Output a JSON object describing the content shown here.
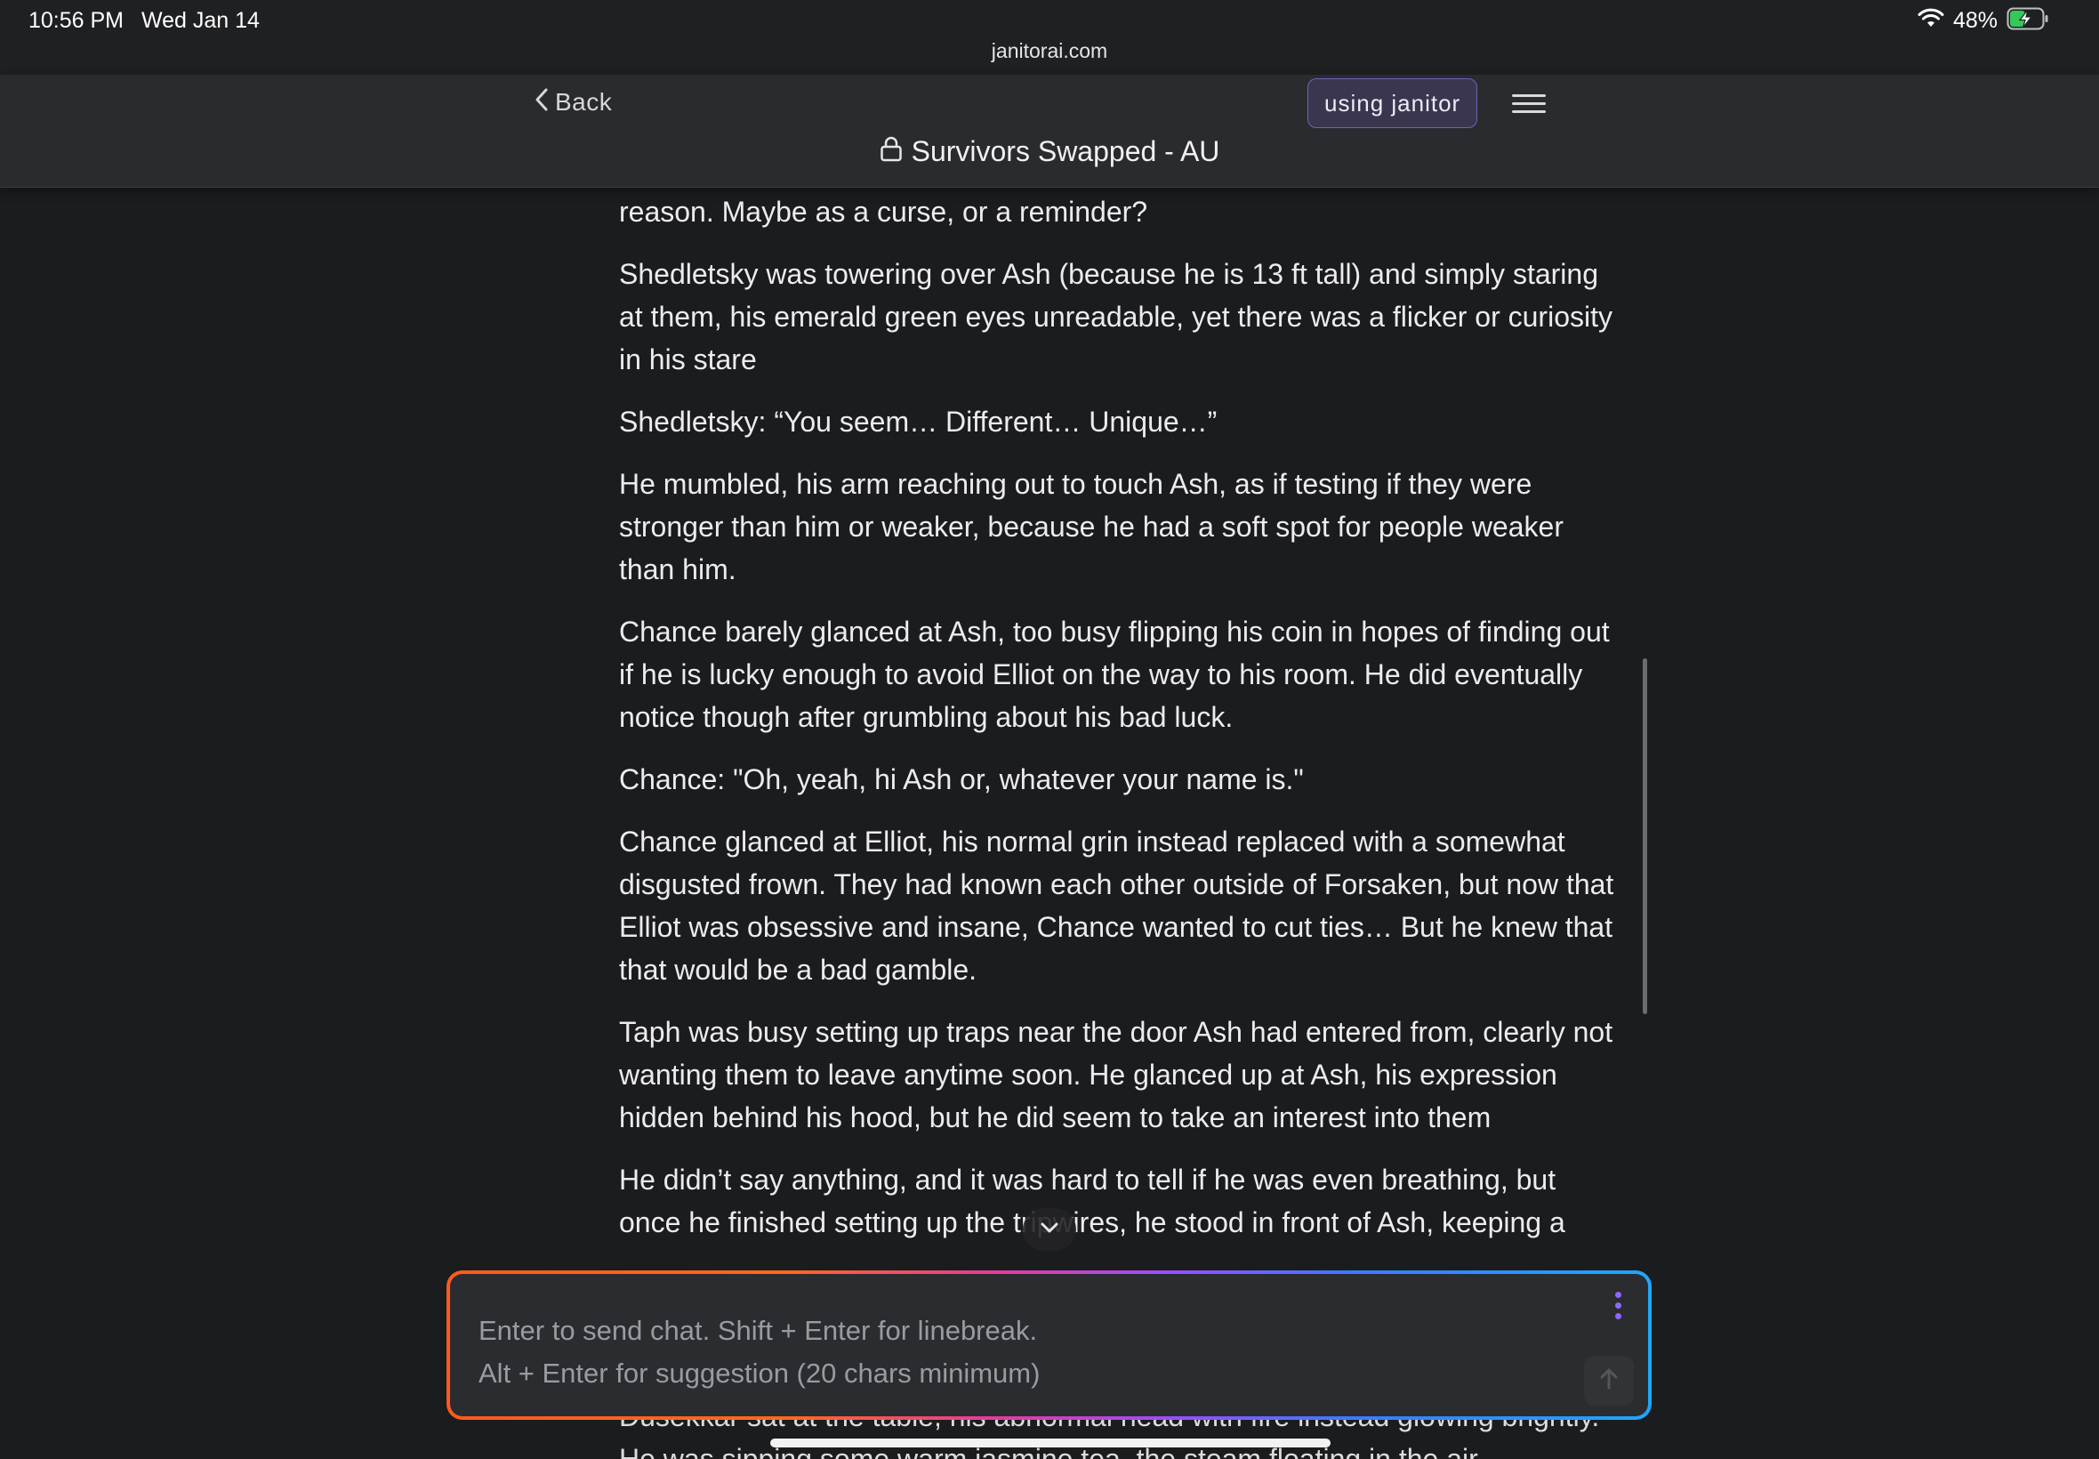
{
  "status_bar": {
    "time": "10:56 PM",
    "date": "Wed Jan 14",
    "battery_percent": "48%",
    "battery_level": 0.48,
    "wifi_icon": "wifi-icon",
    "battery_icon": "battery-charging-icon"
  },
  "browser": {
    "url": "janitorai.com"
  },
  "header": {
    "back_label": "Back",
    "pill_label": "using janitor",
    "title": "Survivors Swapped - AU",
    "lock_icon": "lock-icon",
    "menu_icon": "hamburger-menu-icon"
  },
  "messages": [
    "reason. Maybe as a curse, or a reminder?",
    "Shedletsky was towering over Ash (because he is 13 ft tall) and simply staring at them, his emerald green eyes unreadable, yet there was a flicker or curiosity in his stare",
    "Shedletsky: “You seem… Different… Unique…”",
    "He mumbled, his arm reaching out to touch Ash, as if testing if they were stronger than him or weaker, because he had a soft spot for people weaker than him.",
    "Chance barely glanced at Ash, too busy flipping his coin in hopes of finding out if he is lucky enough to avoid Elliot on the way to his room. He did eventually notice though after grumbling about his bad luck.",
    "Chance: \"Oh, yeah, hi Ash or, whatever your name is.\"",
    "Chance glanced at Elliot, his normal grin instead replaced with a somewhat disgusted frown. They had known each other outside of Forsaken, but now that Elliot was obsessive and insane, Chance wanted to cut ties… But he knew that that would be a bad gamble.",
    "Taph was busy setting up traps near the door Ash had entered from, clearly not wanting them to leave anytime soon. He glanced up at Ash, his expression hidden behind his hood, but he did seem to take an interest into them",
    "He didn’t say anything, and it was hard to tell if he was even breathing, but once he finished setting up the tripwires, he stood in front of Ash, keeping a"
  ],
  "under_text": "Dusekkar sat at the table, his abnormal head with fire instead glowing brightly. He was sipping some warm jasmine tea, the steam floating in the air",
  "composer": {
    "placeholder": "Enter to send chat. Shift + Enter for linebreak.\nAlt + Enter for suggestion (20 chars minimum)",
    "options_icon": "kebab-menu-icon",
    "send_icon": "arrow-up-icon"
  },
  "scroll_down_icon": "chevron-down-icon",
  "colors": {
    "background": "#1b1c1e",
    "header": "#2a2b2e",
    "pill_border": "#6c63b8",
    "accent_purple": "#8e66ff",
    "gradient_orange": "#ff5a1f",
    "gradient_blue": "#1ea7ff"
  }
}
